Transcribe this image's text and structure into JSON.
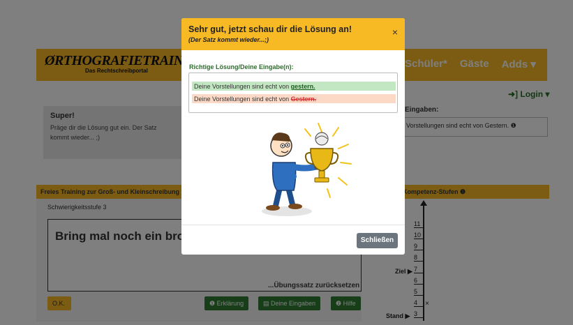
{
  "background": {
    "logo": {
      "main": "ØRTHOGRAFIETRAINER",
      "sub": "Das Rechtschreibportal"
    },
    "nav": [
      "Schüler*",
      "Gäste",
      "Adds ▾"
    ],
    "login": "➜] Login ▾",
    "feedback": {
      "title": "Super!",
      "text": "Präge dir die Lösung gut ein. Der Satz kommt wieder... ;)"
    },
    "eingaben": {
      "title": "Eingaben:",
      "text": "Vorstellungen sind echt von Gestern. ❶"
    },
    "training": {
      "header": "Freies Training zur Groß- und Kleinschreibung",
      "level": "Schwierigkeitsstufe 3",
      "sentence": "Bring mal noch ein brot mit!",
      "reset": "...Übungssatz zurücksetzen",
      "ok_label": "O.K.",
      "erklaerung": "❶ Erklärung",
      "eingaben_btn": "▤ Deine Eingaben",
      "hilfe": "❷ Hilfe"
    },
    "kompetenz": {
      "header": "Kompetenz-Stufen ❶",
      "ticks": [
        "11",
        "10",
        "9",
        "8",
        "7",
        "6",
        "5",
        "4",
        "3"
      ],
      "ziel_label": "Ziel ▶",
      "stand_label": "Stand ▶",
      "marker": "×"
    }
  },
  "modal": {
    "title": "Sehr gut, jetzt schau dir die Lösung an!",
    "subtitle": "(Der Satz kommt wieder...;)",
    "close_icon": "×",
    "solution_label": "Richtige Lösung/Deine Eingabe(n):",
    "correct": {
      "prefix": "Deine Vorstellungen sind echt von ",
      "word": "gestern."
    },
    "wrong": {
      "prefix": "Deine Vorstellungen sind echt von ",
      "word": "Gestern."
    },
    "close_button": "Schließen"
  }
}
